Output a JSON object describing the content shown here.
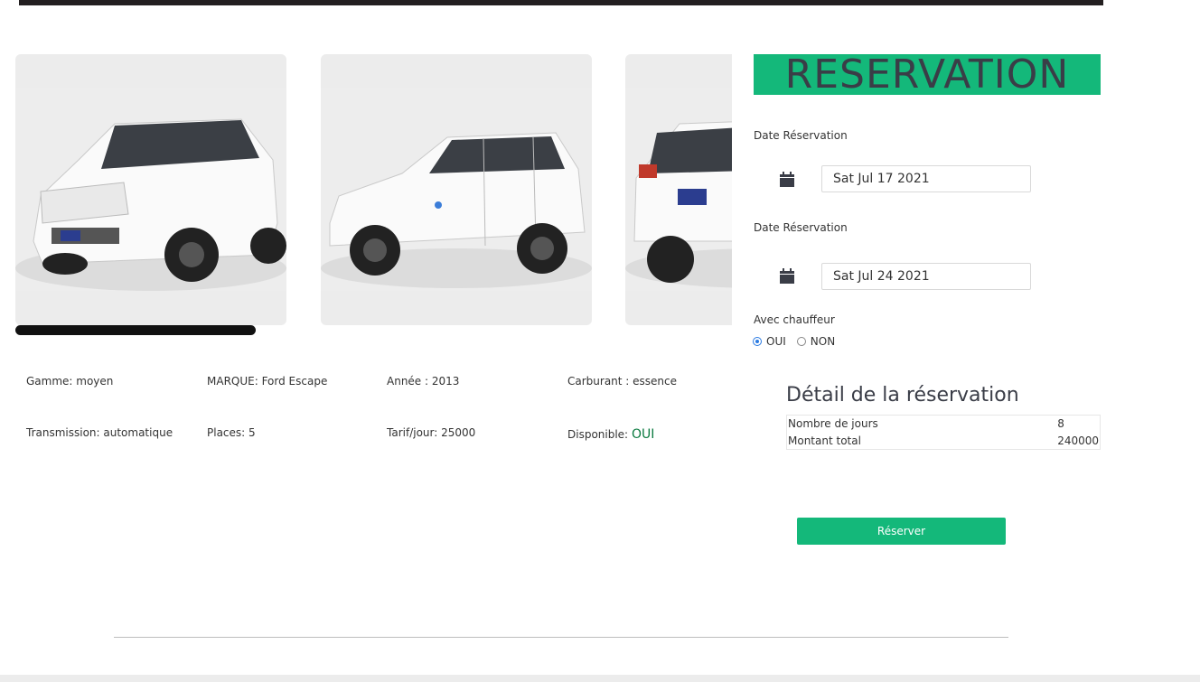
{
  "reservation": {
    "title": "RESERVATION",
    "date_label_1": "Date Réservation",
    "date_value_1": "Sat Jul 17 2021",
    "date_label_2": "Date Réservation",
    "date_value_2": "Sat Jul 24 2021",
    "chauffeur_label": "Avec chauffeur",
    "option_yes": "OUI",
    "option_no": "NON",
    "selected_option": "OUI",
    "detail_title": "Détail de la réservation",
    "days_label": "Nombre de jours",
    "days_value": "8",
    "total_label": "Montant total",
    "total_value": "240000",
    "submit_label": "Réserver"
  },
  "specs": {
    "gamme": "Gamme: moyen",
    "marque": "MARQUE: Ford Escape",
    "annee": "Année : 2013",
    "carburant": "Carburant : essence",
    "transmission": "Transmission: automatique",
    "places": "Places: 5",
    "tarif": "Tarif/jour: 25000",
    "disponible_label": "Disponible:",
    "disponible_value": "OUI"
  },
  "gallery": {
    "images": [
      "car-front-three-quarter-photo",
      "car-side-photo",
      "car-rear-three-quarter-photo"
    ]
  },
  "colors": {
    "accent": "#14b87a",
    "title_text": "#3a3d47",
    "available": "#0a7a3f"
  }
}
